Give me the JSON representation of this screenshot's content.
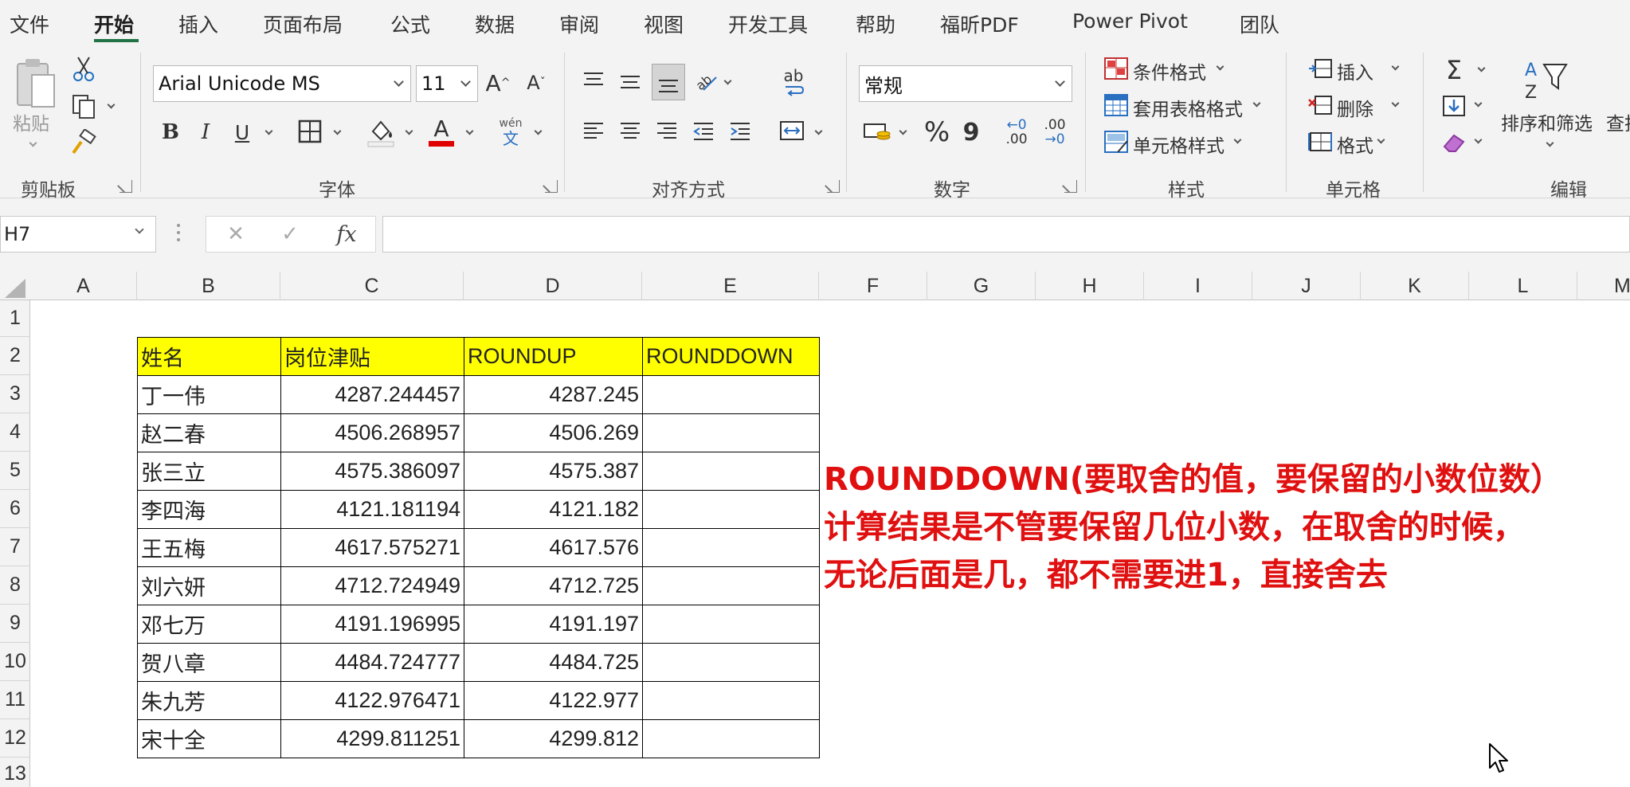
{
  "menu": {
    "tabs": [
      "文件",
      "开始",
      "插入",
      "页面布局",
      "公式",
      "数据",
      "审阅",
      "视图",
      "开发工具",
      "帮助",
      "福昕PDF",
      "Power Pivot",
      "团队"
    ],
    "active": "开始"
  },
  "ribbon": {
    "clipboard": {
      "paste_label": "粘贴",
      "group_label": "剪贴板"
    },
    "font": {
      "font_name": "Arial Unicode MS",
      "font_size": "11",
      "group_label": "字体",
      "phonetic_glyph": "wén",
      "phonetic_char": "文"
    },
    "alignment": {
      "group_label": "对齐方式",
      "wrap_glyph": "ab"
    },
    "number": {
      "format": "常规",
      "group_label": "数字",
      "percent": "%",
      "comma": "9",
      "inc_decimal": ".00",
      "dec_decimal": ".00"
    },
    "styles": {
      "conditional": "条件格式",
      "table_format": "套用表格格式",
      "cell_style": "单元格样式",
      "group_label": "样式"
    },
    "cells": {
      "insert": "插入",
      "delete": "删除",
      "format": "格式",
      "group_label": "单元格"
    },
    "editing": {
      "sort_filter": "排序和筛选",
      "find": "查找",
      "group_label": "编辑"
    },
    "accent_color": "#217346",
    "font_color_bar": "#e00000"
  },
  "formula_bar": {
    "name_box": "H7",
    "fx": "fx",
    "formula": ""
  },
  "columns": [
    "A",
    "B",
    "C",
    "D",
    "E",
    "F",
    "G",
    "H",
    "I",
    "J",
    "K",
    "L",
    "M"
  ],
  "rows": [
    "1",
    "2",
    "3",
    "4",
    "5",
    "6",
    "7",
    "8",
    "9",
    "10",
    "11",
    "12",
    "13"
  ],
  "table": {
    "headers": [
      "姓名",
      "岗位津贴",
      "ROUNDUP",
      "ROUNDDOWN"
    ],
    "header_fill": "#ffff00",
    "rows": [
      [
        "丁一伟",
        "4287.244457",
        "4287.245",
        ""
      ],
      [
        "赵二春",
        "4506.268957",
        "4506.269",
        ""
      ],
      [
        "张三立",
        "4575.386097",
        "4575.387",
        ""
      ],
      [
        "李四海",
        "4121.181194",
        "4121.182",
        ""
      ],
      [
        "王五梅",
        "4617.575271",
        "4617.576",
        ""
      ],
      [
        "刘六妍",
        "4712.724949",
        "4712.725",
        ""
      ],
      [
        "邓七万",
        "4191.196995",
        "4191.197",
        ""
      ],
      [
        "贺八章",
        "4484.724777",
        "4484.725",
        ""
      ],
      [
        "朱九芳",
        "4122.976471",
        "4122.977",
        ""
      ],
      [
        "宋十全",
        "4299.811251",
        "4299.812",
        ""
      ]
    ]
  },
  "annotation": {
    "lines": [
      "ROUNDDOWN(要取舍的值，要保留的小数位数）",
      "计算结果是不管要保留几位小数，在取舍的时候，",
      "无论后面是几，都不需要进1，直接舍去"
    ],
    "color": "#e01010"
  }
}
